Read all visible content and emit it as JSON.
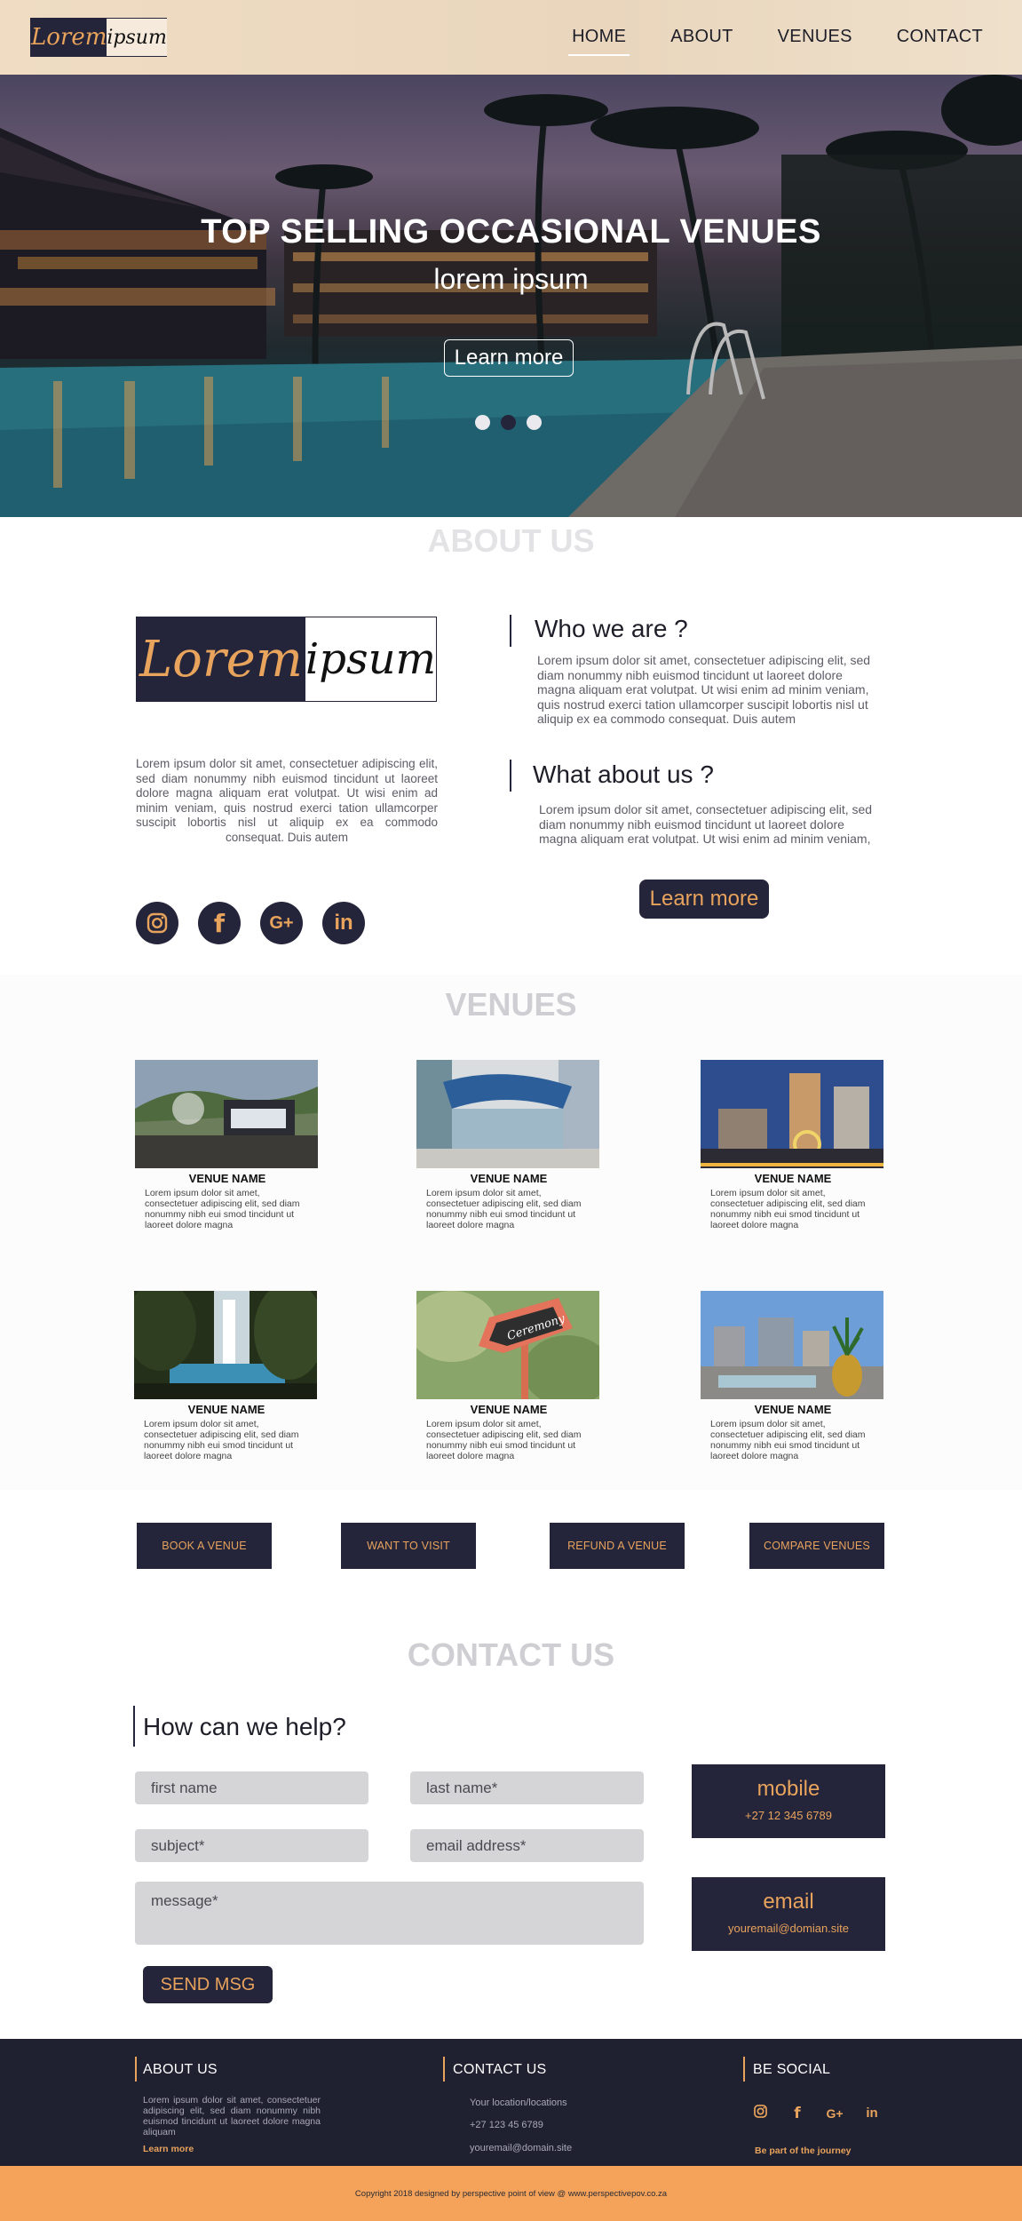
{
  "nav": {
    "logo_left": "Lorem",
    "logo_right": "ipsum",
    "items": [
      "HOME",
      "ABOUT",
      "VENUES",
      "CONTACT"
    ]
  },
  "hero": {
    "title": "TOP SELLING OCCASIONAL VENUES",
    "subtitle": "lorem ipsum",
    "button": "Learn more",
    "slide_count": 3,
    "active_slide": 2
  },
  "about": {
    "title": "ABOUT US",
    "logo_left": "Lorem",
    "logo_right": "ipsum",
    "text": "Lorem ipsum dolor sit amet, consectetuer adipiscing elit, sed diam nonummy nibh euismod tincidunt ut laoreet dolore magna aliquam erat volutpat. Ut wisi enim ad minim veniam, quis nostrud exerci tation ullamcorper suscipit lobortis nisl ut aliquip ex ea commodo consequat. Duis autem",
    "social_icons": [
      "instagram-icon",
      "facebook-icon",
      "google-plus-icon",
      "linkedin-icon"
    ],
    "who_heading": "Who we are ?",
    "who_text": "Lorem ipsum dolor sit amet, consectetuer adipiscing elit, sed diam nonummy nibh euismod tincidunt ut laoreet dolore magna aliquam erat volutpat. Ut wisi enim ad minim veniam, quis nostrud exerci tation ullamcorper suscipit lobortis nisl ut aliquip ex ea commodo consequat. Duis autem",
    "what_heading": "What about us ?",
    "what_text": "Lorem ipsum dolor sit amet, consectetuer adipiscing elit, sed diam nonummy nibh euismod tincidunt ut laoreet dolore magna aliquam erat volutpat. Ut wisi enim ad minim veniam,",
    "button": "Learn more"
  },
  "venues": {
    "title": "VENUES",
    "items": [
      {
        "name": "VENUE NAME",
        "desc": "Lorem ipsum dolor sit amet, consectetuer adipiscing elit, sed diam nonummy nibh eui smod tincidunt ut laoreet dolore magna"
      },
      {
        "name": "VENUE NAME",
        "desc": "Lorem ipsum dolor sit amet, consectetuer adipiscing elit, sed diam nonummy nibh eui smod tincidunt ut laoreet dolore magna"
      },
      {
        "name": "VENUE NAME",
        "desc": "Lorem ipsum dolor sit amet, consectetuer adipiscing elit, sed diam nonummy nibh eui smod tincidunt ut laoreet dolore magna"
      },
      {
        "name": "VENUE NAME",
        "desc": "Lorem ipsum dolor sit amet, consectetuer adipiscing elit, sed diam nonummy nibh eui smod tincidunt ut laoreet dolore magna"
      },
      {
        "name": "VENUE NAME",
        "desc": "Lorem ipsum dolor sit amet, consectetuer adipiscing elit, sed diam nonummy nibh eui smod tincidunt ut laoreet dolore magna"
      },
      {
        "name": "VENUE NAME",
        "desc": "Lorem ipsum dolor sit amet, consectetuer adipiscing elit, sed diam nonummy nibh eui smod tincidunt ut laoreet dolore magna"
      }
    ],
    "actions": [
      "BOOK A VENUE",
      "WANT TO VISIT",
      "REFUND A VENUE",
      "COMPARE VENUES"
    ]
  },
  "contact": {
    "title": "CONTACT US",
    "heading": "How can we help?",
    "first_name_placeholder": "first name",
    "last_name_placeholder": "last name*",
    "subject_placeholder": "subject*",
    "email_placeholder": "email address*",
    "message_placeholder": "message*",
    "send_button": "SEND MSG",
    "mobile_label": "mobile",
    "mobile_value": "+27 12 345 6789",
    "email_label": "email",
    "email_value": "youremail@domian.site"
  },
  "footer": {
    "about_heading": "ABOUT US",
    "about_text": "Lorem ipsum dolor sit amet, consectetuer adipiscing elit, sed diam nonummy nibh euismod tincidunt ut laoreet dolore magna aliquam",
    "about_link": "Learn more",
    "contact_heading": "CONTACT US",
    "contact_location": "Your location/locations",
    "contact_phone": "+27 123 45 6789",
    "contact_email": "youremail@domain.site",
    "social_heading": "BE SOCIAL",
    "social_icons": [
      "instagram-icon",
      "facebook-icon",
      "google-plus-icon",
      "linkedin-icon"
    ],
    "social_link": "Be part of the journey",
    "copyright": "Copyright 2018 designed by perspective point of view @ www.perspectivepov.co.za"
  },
  "colors": {
    "navy": "#24243a",
    "accent_orange": "#e8a35c",
    "nav_bg": "#efdcc2",
    "footer_bg": "#1f2030",
    "copyright_bg": "#f5a35a"
  }
}
